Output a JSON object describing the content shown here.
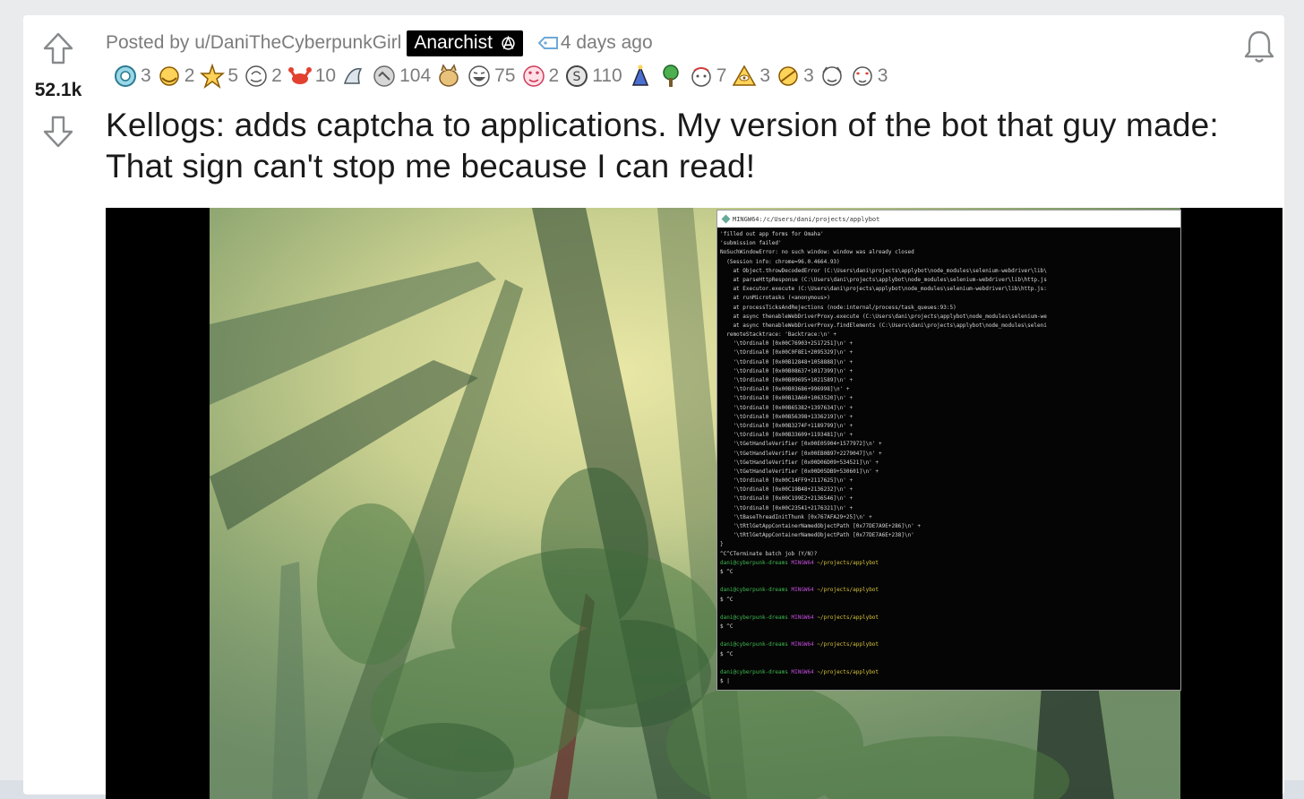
{
  "post": {
    "score": "52.1k",
    "posted_by_prefix": "Posted by",
    "username": "u/DaniTheCyberpunkGirl",
    "flair": "Anarchist",
    "time": "4 days ago",
    "title": "Kellogs: adds captcha to applications. My version of the bot that guy made: That sign can't stop me because I can read!"
  },
  "awards": [
    {
      "icon": "wholesome-award-icon",
      "count": "3"
    },
    {
      "icon": "hugz-award-icon",
      "count": "2"
    },
    {
      "icon": "starstruck-award-icon",
      "count": "5"
    },
    {
      "icon": "take-my-energy-award-icon",
      "count": "2"
    },
    {
      "icon": "crab-rave-award-icon",
      "count": "10"
    },
    {
      "icon": "shark-award-icon",
      "count": ""
    },
    {
      "icon": "silver-award-icon",
      "count": "104"
    },
    {
      "icon": "doge-award-icon",
      "count": ""
    },
    {
      "icon": "laughing-award-icon",
      "count": "75"
    },
    {
      "icon": "heart-eyes-award-icon",
      "count": "2"
    },
    {
      "icon": "helpful-award-icon",
      "count": "110"
    },
    {
      "icon": "party-award-icon",
      "count": ""
    },
    {
      "icon": "tree-hug-award-icon",
      "count": ""
    },
    {
      "icon": "facepalm-award-icon",
      "count": "7"
    },
    {
      "icon": "illuminati-award-icon",
      "count": "3"
    },
    {
      "icon": "rocket-like-award-icon",
      "count": "3"
    },
    {
      "icon": "bravo-award-icon",
      "count": ""
    },
    {
      "icon": "love-award-icon",
      "count": "3"
    }
  ],
  "terminal": {
    "title": "MINGW64:/c/Users/dani/projects/applybot",
    "lines": [
      {
        "t": "'filled out app forms for Omaha'",
        "c": ""
      },
      {
        "t": "'submission failed'",
        "c": ""
      },
      {
        "t": "NoSuchWindowError: no such window: window was already closed",
        "c": ""
      },
      {
        "t": "  (Session info: chrome=96.0.4664.93)",
        "c": ""
      },
      {
        "t": "    at Object.throwDecodedError (C:\\Users\\dani\\projects\\applybot\\node_modules\\selenium-webdriver\\lib\\",
        "c": ""
      },
      {
        "t": "    at parseHttpResponse (C:\\Users\\dani\\projects\\applybot\\node_modules\\selenium-webdriver\\lib\\http.js",
        "c": ""
      },
      {
        "t": "    at Executor.execute (C:\\Users\\dani\\projects\\applybot\\node_modules\\selenium-webdriver\\lib\\http.js:",
        "c": ""
      },
      {
        "t": "    at runMicrotasks (<anonymous>)",
        "c": ""
      },
      {
        "t": "    at processTicksAndRejections (node:internal/process/task_queues:93:5)",
        "c": ""
      },
      {
        "t": "    at async thenableWebDriverProxy.execute (C:\\Users\\dani\\projects\\applybot\\node_modules\\selenium-we",
        "c": ""
      },
      {
        "t": "    at async thenableWebDriverProxy.findElements (C:\\Users\\dani\\projects\\applybot\\node_modules\\seleni",
        "c": ""
      },
      {
        "t": "  remoteStacktrace: 'Backtrace:\\n' +",
        "c": ""
      },
      {
        "t": "    '\\tOrdinal0 [0x00C76903+2517251]\\n' +",
        "c": ""
      },
      {
        "t": "    '\\tOrdinal0 [0x00C0F8E1+2095329]\\n' +",
        "c": ""
      },
      {
        "t": "    '\\tOrdinal0 [0x00B12848+1058888]\\n' +",
        "c": ""
      },
      {
        "t": "    '\\tOrdinal0 [0x00B08637+1017399]\\n' +",
        "c": ""
      },
      {
        "t": "    '\\tOrdinal0 [0x00B09695+1021589]\\n' +",
        "c": ""
      },
      {
        "t": "    '\\tOrdinal0 [0x00B03686+996998]\\n' +",
        "c": ""
      },
      {
        "t": "    '\\tOrdinal0 [0x00B13A60+1063520]\\n' +",
        "c": ""
      },
      {
        "t": "    '\\tOrdinal0 [0x00B65382+1397634]\\n' +",
        "c": ""
      },
      {
        "t": "    '\\tOrdinal0 [0x00B56398+1336219]\\n' +",
        "c": ""
      },
      {
        "t": "    '\\tOrdinal0 [0x00B3274F+1189799]\\n' +",
        "c": ""
      },
      {
        "t": "    '\\tOrdinal0 [0x00B33609+1193481]\\n' +",
        "c": ""
      },
      {
        "t": "    '\\tGetHandleVerifier [0x00E05904+1577972]\\n' +",
        "c": ""
      },
      {
        "t": "    '\\tGetHandleVerifier [0x00EB0B97+2279047]\\n' +",
        "c": ""
      },
      {
        "t": "    '\\tGetHandleVerifier [0x00D06D09+534521]\\n' +",
        "c": ""
      },
      {
        "t": "    '\\tGetHandleVerifier [0x00D05DB9+530601]\\n' +",
        "c": ""
      },
      {
        "t": "    '\\tOrdinal0 [0x00C14FF9+2117625]\\n' +",
        "c": ""
      },
      {
        "t": "    '\\tOrdinal0 [0x00C19B48+2136232]\\n' +",
        "c": ""
      },
      {
        "t": "    '\\tOrdinal0 [0x00C199E2+2136546]\\n' +",
        "c": ""
      },
      {
        "t": "    '\\tOrdinal0 [0x00C23541+2176321]\\n' +",
        "c": ""
      },
      {
        "t": "    '\\tBaseThreadInitThunk [0x767AFA29+25]\\n' +",
        "c": ""
      },
      {
        "t": "    '\\tRtlGetAppContainerNamedObjectPath [0x77DE7A9E+286]\\n' +",
        "c": ""
      },
      {
        "t": "    '\\tRtlGetAppContainerNamedObjectPath [0x77DE7A6E+238]\\n'",
        "c": ""
      },
      {
        "t": "}",
        "c": ""
      },
      {
        "t": "^C^CTerminate batch job (Y/N)?",
        "c": ""
      },
      {
        "t": "dani@cyberpunk-dreams MINGW64 ~/projects/applybot",
        "c": "prompt"
      },
      {
        "t": "$ ^C",
        "c": ""
      },
      {
        "t": "",
        "c": ""
      },
      {
        "t": "dani@cyberpunk-dreams MINGW64 ~/projects/applybot",
        "c": "prompt"
      },
      {
        "t": "$ ^C",
        "c": ""
      },
      {
        "t": "",
        "c": ""
      },
      {
        "t": "dani@cyberpunk-dreams MINGW64 ~/projects/applybot",
        "c": "prompt"
      },
      {
        "t": "$ ^C",
        "c": ""
      },
      {
        "t": "",
        "c": ""
      },
      {
        "t": "dani@cyberpunk-dreams MINGW64 ~/projects/applybot",
        "c": "prompt"
      },
      {
        "t": "$ ^C",
        "c": ""
      },
      {
        "t": "",
        "c": ""
      },
      {
        "t": "dani@cyberpunk-dreams MINGW64 ~/projects/applybot",
        "c": "prompt"
      },
      {
        "t": "$ |",
        "c": ""
      }
    ]
  },
  "colors": {
    "page_bg": "#e9ebed",
    "card_bg": "#ffffff",
    "meta_text": "#7c7c7c",
    "title_text": "#1a1a1b",
    "flair_bg": "#000000",
    "tag_blue": "#6ea8d8"
  }
}
